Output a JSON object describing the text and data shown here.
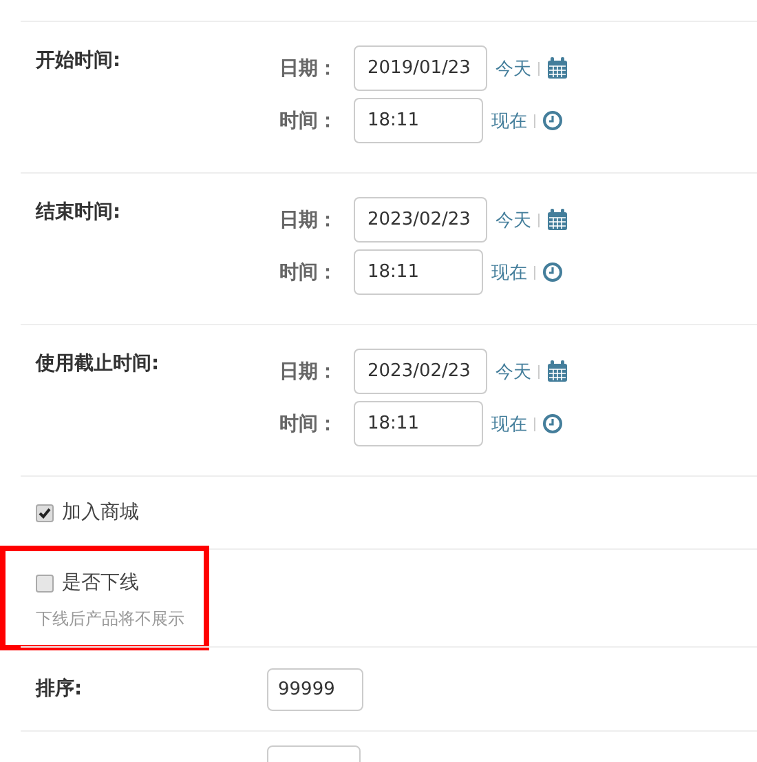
{
  "datetime_fields": [
    {
      "label": "开始时间:",
      "date_label": "日期：",
      "date": "2019/01/23",
      "today_link": "今天",
      "time_label": "时间：",
      "time": "18:11",
      "now_link": "现在"
    },
    {
      "label": "结束时间:",
      "date_label": "日期：",
      "date": "2023/02/23",
      "today_link": "今天",
      "time_label": "时间：",
      "time": "18:11",
      "now_link": "现在"
    },
    {
      "label": "使用截止时间:",
      "date_label": "日期：",
      "date": "2023/02/23",
      "today_link": "今天",
      "time_label": "时间：",
      "time": "18:11",
      "now_link": "现在"
    }
  ],
  "checkboxes": [
    {
      "label": "加入商城",
      "checked": true,
      "highlighted": false
    },
    {
      "label": "是否下线",
      "checked": false,
      "help": "下线后产品将不展示",
      "highlighted": true
    }
  ],
  "sort_field": {
    "label": "排序:",
    "value": "99999"
  }
}
